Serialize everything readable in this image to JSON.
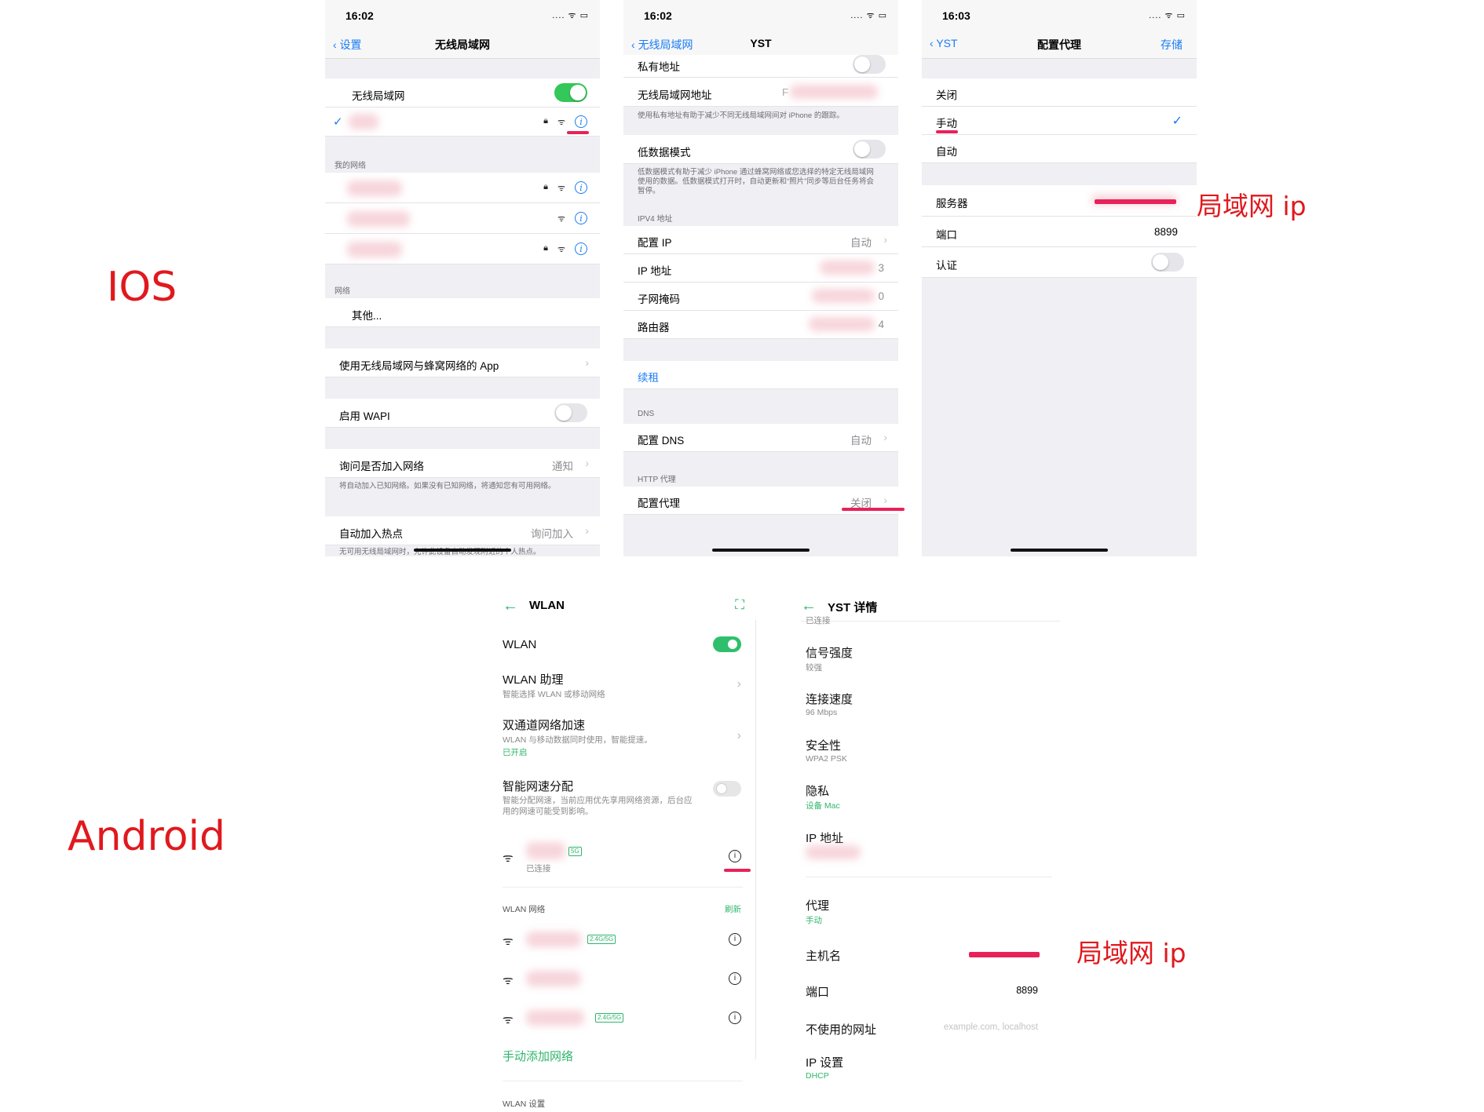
{
  "labels": {
    "ios": "IOS",
    "android": "Android"
  },
  "annotations": {
    "lan_ip_1": "局域网 ip",
    "lan_ip_2": "局域网 ip"
  },
  "ios1": {
    "time": "16:02",
    "back": "设置",
    "title": "无线局域网",
    "wifi_label": "无线局域网",
    "section_my": "我的网络",
    "section_net": "网络",
    "other": "其他...",
    "apps_row": "使用无线局域网与蜂窝网络的 App",
    "wapi": "启用 WAPI",
    "ask_join": "询问是否加入网络",
    "ask_join_val": "通知",
    "ask_note": "将自动加入已知网络。如果没有已知网络，将通知您有可用网络。",
    "hotspot": "自动加入热点",
    "hotspot_val": "询问加入",
    "hotspot_note": "无可用无线局域网时，允许此设备自动发现附近的个人热点。"
  },
  "ios2": {
    "time": "16:02",
    "back": "无线局域网",
    "title": "YST",
    "private_addr": "私有地址",
    "wifi_addr": "无线局域网地址",
    "wifi_addr_val": "F",
    "private_note": "使用私有地址有助于减少不同无线局域网间对 iPhone 的跟踪。",
    "low_data": "低数据模式",
    "low_note": "低数据模式有助于减少 iPhone 通过蜂窝网络或您选择的特定无线局域网使用的数据。低数据模式打开时，自动更新和“照片”同步等后台任务将会暂停。",
    "ipv4": "IPV4 地址",
    "config_ip": "配置 IP",
    "config_ip_val": "自动",
    "ip_addr": "IP 地址",
    "ip_addr_tail": "3",
    "subnet": "子网掩码",
    "subnet_tail": "0",
    "router": "路由器",
    "router_tail": "4",
    "renew": "续租",
    "dns_sec": "DNS",
    "config_dns": "配置 DNS",
    "config_dns_val": "自动",
    "http_sec": "HTTP 代理",
    "config_proxy": "配置代理",
    "config_proxy_val": "关闭"
  },
  "ios3": {
    "time": "16:03",
    "back": "YST",
    "title": "配置代理",
    "save": "存储",
    "off": "关闭",
    "manual": "手动",
    "auto": "自动",
    "server": "服务器",
    "port": "端口",
    "port_val": "8899",
    "auth": "认证"
  },
  "and1": {
    "title": "WLAN",
    "wlan": "WLAN",
    "assistant": "WLAN 助理",
    "assistant_sub": "智能选择 WLAN 或移动网络",
    "dual": "双通道网络加速",
    "dual_sub": "WLAN 与移动数据同时使用，智能提速。",
    "dual_status": "已开启",
    "smart": "智能网速分配",
    "smart_sub": "智能分配网速，当前应用优先享用网络资源，后台应用的网速可能受到影响。",
    "connected": "已连接",
    "band_5g": "5G",
    "networks_sec": "WLAN 网络",
    "refresh": "刷新",
    "band_dual": "2.4G/5G",
    "add_manual": "手动添加网络",
    "settings_sec": "WLAN 设置"
  },
  "and2": {
    "title": "YST 详情",
    "connected_top": "已连接",
    "signal": "信号强度",
    "signal_val": "较强",
    "speed": "连接速度",
    "speed_val": "96 Mbps",
    "security": "安全性",
    "security_val": "WPA2 PSK",
    "privacy": "隐私",
    "privacy_val": "设备 Mac",
    "ip": "IP 地址",
    "proxy": "代理",
    "proxy_val": "手动",
    "hostname": "主机名",
    "port": "端口",
    "port_val": "8899",
    "bypass": "不使用的网址",
    "bypass_placeholder": "example.com, localhost",
    "ip_settings": "IP 设置",
    "ip_settings_val": "DHCP"
  }
}
